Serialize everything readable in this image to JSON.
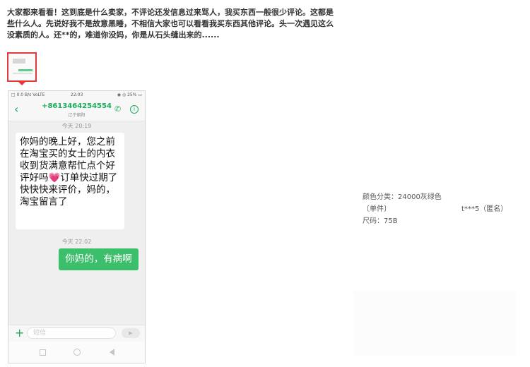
{
  "review": {
    "text": "大家都来看看！这到底是什么卖家，不评论还发信息过来骂人，我买东西一般很少评论。这都是些什么人。先说好我不是故意黑睡，不相信大家也可以看看我买东西其他评论。头一次遇见这么没素质的人。还**的，难道你没妈，你是从石头缝出来的......"
  },
  "thumbnail": {
    "border_color": "#e4393c"
  },
  "phone": {
    "status_left": "□ 0.0 B/s VoLTE",
    "status_time": "22:03",
    "status_right": "◉ ◎ 25% ▭",
    "header": {
      "number": "+8613464254554",
      "region": "辽宁朝阳",
      "back_icon": "chevron-left",
      "call_icon": "phone",
      "info_icon": "info"
    },
    "messages": [
      {
        "timestamp": "今天 20:19",
        "direction": "incoming",
        "text": "你妈的晚上好，您之前在淘宝买的女士的内衣收到货满意帮忙点个好评好吗💗订单快过期了快快快来评价，妈的，淘宝留言了"
      },
      {
        "timestamp": "今天 22:02",
        "direction": "outgoing",
        "text": "你妈的，有病啊"
      }
    ],
    "input": {
      "placeholder": "短信",
      "plus_icon": "plus",
      "send_icon": "send"
    },
    "colors": {
      "accent": "#1aad5c",
      "outgoing_bubble": "#3cbf6b"
    }
  },
  "order_meta": {
    "color": "颜色分类：24000灰绿色",
    "unit": "〔单件〕",
    "user": "t***5（匿名）",
    "size": "尺码：75B"
  }
}
